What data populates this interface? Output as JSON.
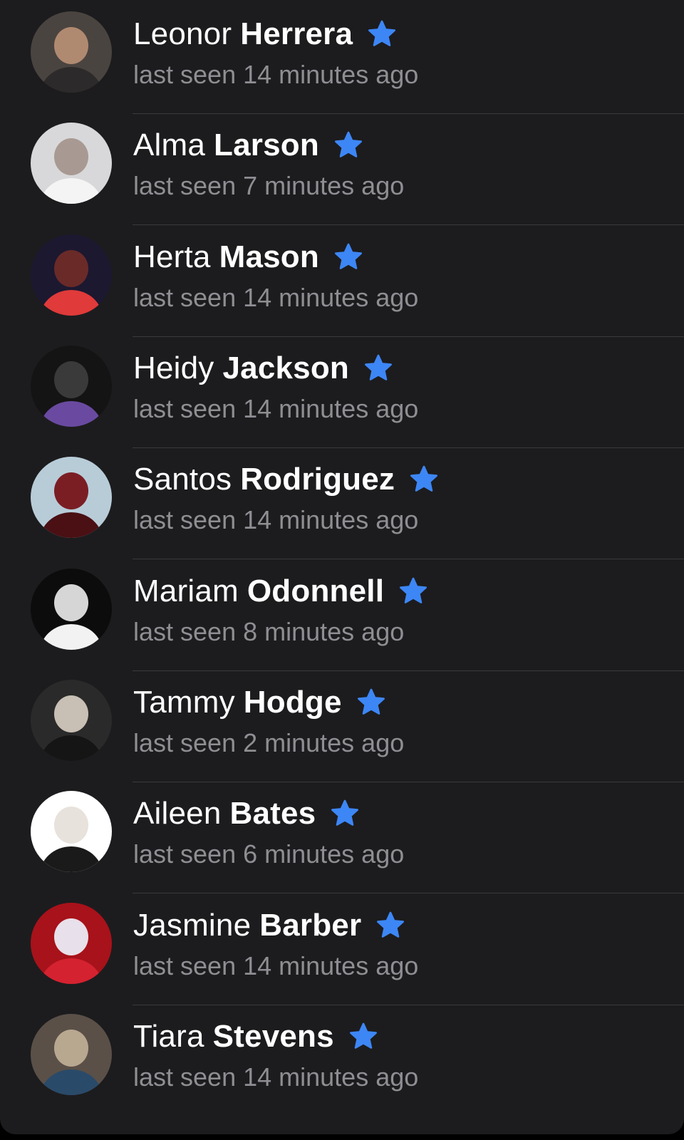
{
  "contacts": [
    {
      "first": "Leonor",
      "last": "Herrera",
      "status": "last seen 14 minutes ago",
      "avatar_colors": [
        "#4a4440",
        "#b08a70",
        "#2c2a2a"
      ]
    },
    {
      "first": "Alma",
      "last": "Larson",
      "status": "last seen 7 minutes ago",
      "avatar_colors": [
        "#d8d8da",
        "#a89a92",
        "#f4f4f4"
      ]
    },
    {
      "first": "Herta",
      "last": "Mason",
      "status": "last seen 14 minutes ago",
      "avatar_colors": [
        "#1c1830",
        "#6a2a28",
        "#e03a3a"
      ]
    },
    {
      "first": "Heidy",
      "last": "Jackson",
      "status": "last seen 14 minutes ago",
      "avatar_colors": [
        "#141414",
        "#3a3a3a",
        "#6a4aa0"
      ]
    },
    {
      "first": "Santos",
      "last": "Rodriguez",
      "status": "last seen 14 minutes ago",
      "avatar_colors": [
        "#b8ccd8",
        "#7a1e24",
        "#4a1014"
      ]
    },
    {
      "first": "Mariam",
      "last": "Odonnell",
      "status": "last seen 8 minutes ago",
      "avatar_colors": [
        "#0c0c0c",
        "#d6d6d6",
        "#f2f2f2"
      ]
    },
    {
      "first": "Tammy",
      "last": "Hodge",
      "status": "last seen 2 minutes ago",
      "avatar_colors": [
        "#2a2a2a",
        "#c8bfb5",
        "#151515"
      ]
    },
    {
      "first": "Aileen",
      "last": "Bates",
      "status": "last seen 6 minutes ago",
      "avatar_colors": [
        "#ffffff",
        "#e8e2dc",
        "#1a1a1a"
      ]
    },
    {
      "first": "Jasmine",
      "last": "Barber",
      "status": "last seen 14 minutes ago",
      "avatar_colors": [
        "#a8121a",
        "#e8e0ea",
        "#d42230"
      ]
    },
    {
      "first": "Tiara",
      "last": "Stevens",
      "status": "last seen 14 minutes ago",
      "avatar_colors": [
        "#5a5048",
        "#b8a890",
        "#2a4a6a"
      ]
    }
  ],
  "icons": {
    "favorite": "star-icon"
  },
  "colors": {
    "background": "#1c1c1e",
    "name": "#ffffff",
    "status": "#8e8e93",
    "star": "#3d86f5",
    "separator": "#3a3a3c"
  }
}
